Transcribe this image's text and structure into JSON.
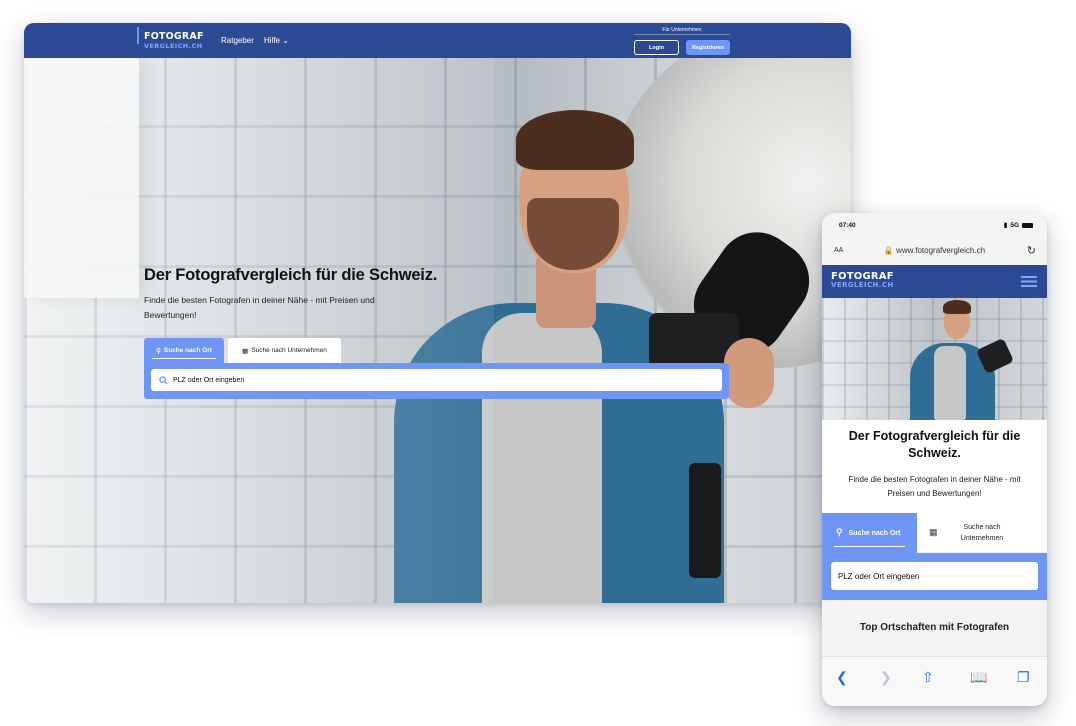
{
  "desktop": {
    "logo": {
      "line1": "FOTOGRAF",
      "line2": "VERGLEICH.CH"
    },
    "nav": {
      "ratgeber": "Ratgeber",
      "hilfe": "Hilfe",
      "hilfe_caret": "⌄"
    },
    "business": {
      "label": "Für Unternehmen",
      "login": "Login",
      "register": "Registrieren"
    },
    "hero": {
      "title": "Der Fotografvergleich für die Schweiz.",
      "subtitle": "Finde die besten Fotografen in deiner Nähe - mit Preisen und Bewertungen!"
    },
    "search": {
      "tab_location": "Suche nach Ort",
      "tab_company": "Suche nach Unternehmen",
      "placeholder": "PLZ oder Ort eingeben"
    }
  },
  "phone": {
    "status": {
      "time": "07:40",
      "network": "5G"
    },
    "browser": {
      "text_size": "AA",
      "address": "www.fotografvergleich.ch"
    },
    "logo": {
      "line1": "FOTOGRAF",
      "line2": "VERGLEICH.CH"
    },
    "hero": {
      "title": "Der Fotografvergleich für die Schweiz.",
      "subtitle": "Finde die besten Fotografen in deiner Nähe - mit Preisen und Bewertungen!"
    },
    "search": {
      "tab_location": "Suche nach Ort",
      "tab_company": "Suche nach Unternehmen",
      "placeholder": "PLZ oder Ort eingeben"
    },
    "section_title": "Top Ortschaften mit Fotografen"
  },
  "colors": {
    "nav": "#2c4a94",
    "accent": "#6f95f7",
    "ios_blue": "#2f6bd8"
  }
}
